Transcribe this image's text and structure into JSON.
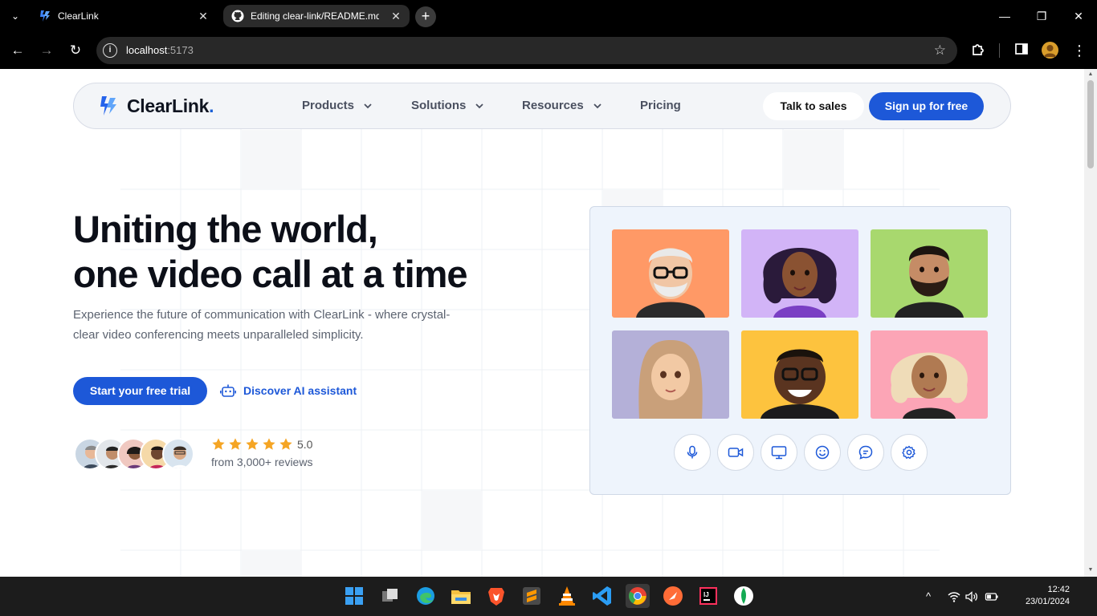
{
  "browser": {
    "tabs": [
      {
        "title": "ClearLink",
        "active": true
      },
      {
        "title": "Editing clear-link/README.md a",
        "active": false
      }
    ],
    "url_host": "localhost",
    "url_port": ":5173"
  },
  "nav": {
    "brand": "ClearLink",
    "brand_dot": ".",
    "items": [
      {
        "label": "Products",
        "has_dropdown": true
      },
      {
        "label": "Solutions",
        "has_dropdown": true
      },
      {
        "label": "Resources",
        "has_dropdown": true
      },
      {
        "label": "Pricing",
        "has_dropdown": false
      }
    ],
    "talk_to_sales": "Talk to sales",
    "sign_up": "Sign up for free"
  },
  "hero": {
    "title_line1": "Uniting the world,",
    "title_line2": "one video call at a time",
    "subtitle": "Experience the future of communication with ClearLink - where crystal-clear video conferencing meets unparalleled simplicity.",
    "cta_trial": "Start your free trial",
    "cta_ai": "Discover AI assistant",
    "rating": {
      "stars": 5,
      "value": "5.0",
      "reviews": "from 3,000+ reviews"
    }
  },
  "video_call": {
    "participants": [
      {
        "bg": "#ff9966"
      },
      {
        "bg": "#d2b4f7"
      },
      {
        "bg": "#a8d86e"
      },
      {
        "bg": "#b4b0d8"
      },
      {
        "bg": "#fdc33e"
      },
      {
        "bg": "#fca5b6"
      }
    ],
    "controls": [
      "microphone-icon",
      "camera-icon",
      "screen-share-icon",
      "emoji-icon",
      "chat-icon",
      "settings-icon"
    ]
  },
  "taskbar": {
    "time": "12:42",
    "date": "23/01/2024"
  },
  "colors": {
    "accent": "#1d58d8",
    "star": "#f5a524"
  }
}
